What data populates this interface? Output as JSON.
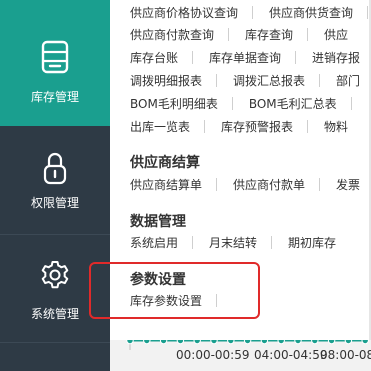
{
  "sidebar": {
    "items": [
      {
        "label": "库存管理",
        "icon": "stock-tray-icon",
        "active": true
      },
      {
        "label": "权限管理",
        "icon": "lock-icon",
        "active": false
      },
      {
        "label": "系统管理",
        "icon": "gear-icon",
        "active": false
      }
    ],
    "colors": {
      "background": "#2e3a45",
      "active": "#1a9f8f"
    }
  },
  "menu": {
    "reports_rows": [
      [
        "供应商价格协议查询",
        "供应商供货查询"
      ],
      [
        "供应商付款查询",
        "库存查询",
        "供应"
      ],
      [
        "库存台账",
        "库存单据查询",
        "进销存报"
      ],
      [
        "调拨明细报表",
        "调拨汇总报表",
        "部门"
      ],
      [
        "BOM毛利明细表",
        "BOM毛利汇总表"
      ],
      [
        "出库一览表",
        "库存预警报表",
        "物料"
      ]
    ],
    "sections": [
      {
        "title": "供应商结算",
        "items": [
          "供应商结算单",
          "供应商付款单",
          "发票"
        ]
      },
      {
        "title": "数据管理",
        "items": [
          "系统启用",
          "月末结转",
          "期初库存"
        ]
      },
      {
        "title": "参数设置",
        "items": [
          "库存参数设置"
        ]
      }
    ],
    "highlight_color": "#e02a2a"
  },
  "chart_data": {
    "type": "line",
    "categories": [
      "00:00-00:59",
      "04:00-04:59",
      "08:00-08:"
    ],
    "series": [
      {
        "values": [
          0,
          0,
          0,
          0,
          0,
          0,
          0,
          0,
          0,
          0,
          0,
          0,
          0,
          0,
          0
        ]
      }
    ],
    "color": "#1a9f8f"
  }
}
